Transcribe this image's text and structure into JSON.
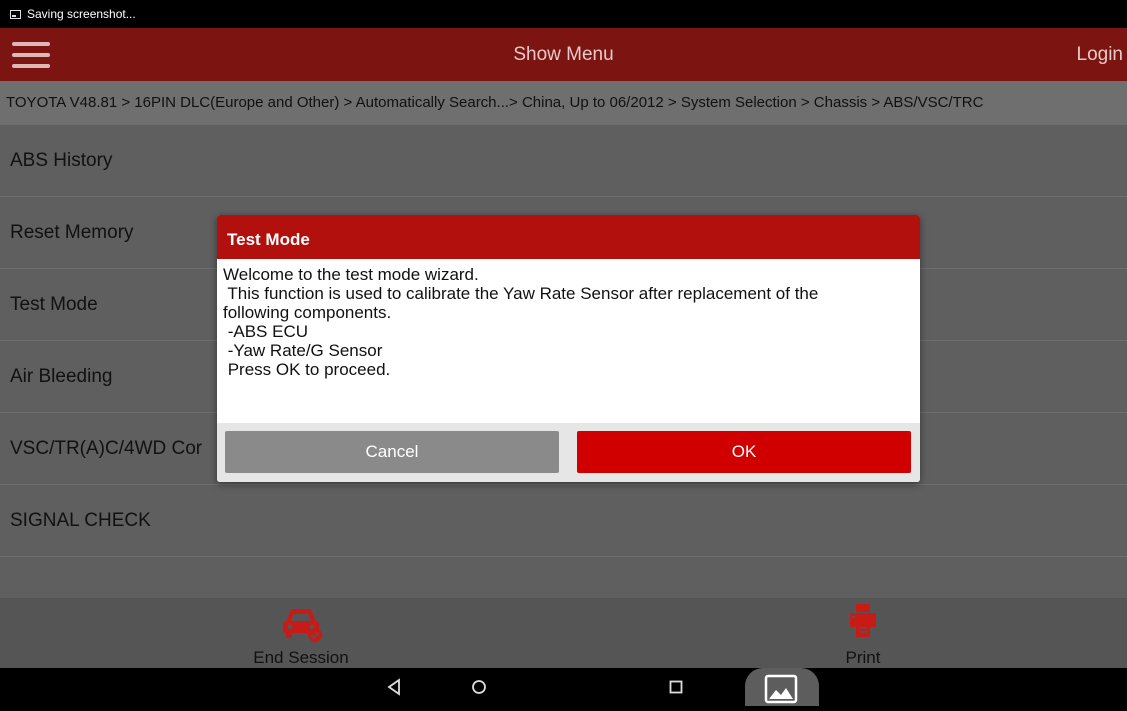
{
  "statusbar": {
    "text": "Saving screenshot..."
  },
  "appbar": {
    "title": "Show Menu",
    "login": "Login"
  },
  "breadcrumb": "TOYOTA V48.81 > 16PIN DLC(Europe and Other) > Automatically Search...> China, Up to 06/2012 > System Selection > Chassis > ABS/VSC/TRC",
  "menu": {
    "items": [
      {
        "label": "ABS History"
      },
      {
        "label": "Reset Memory"
      },
      {
        "label": "Test Mode"
      },
      {
        "label": "Air Bleeding"
      },
      {
        "label": "VSC/TR(A)C/4WD Cor"
      },
      {
        "label": "SIGNAL CHECK"
      }
    ]
  },
  "bottombar": {
    "end_session": "End Session",
    "print": "Print"
  },
  "dialog": {
    "title": "Test Mode",
    "lines": [
      "Welcome to the test mode wizard.",
      " This function is used to calibrate the Yaw Rate Sensor after replacement of the",
      "following components.",
      " -ABS ECU",
      " -Yaw Rate/G Sensor",
      " Press OK to proceed."
    ],
    "cancel": "Cancel",
    "ok": "OK"
  },
  "colors": {
    "appbar": "#7c1512",
    "dialog_header": "#b1100d",
    "ok_button": "#d00000",
    "cancel_button": "#8a8a8a",
    "accent_icon": "#c81b17"
  },
  "icons": {
    "statusbar": "screenshot-icon",
    "appbar": "hamburger-menu-icon",
    "end_session": "car-check-icon",
    "print": "printer-icon",
    "nav": [
      "back-icon",
      "home-icon",
      "recent-apps-icon",
      "image-icon"
    ]
  }
}
